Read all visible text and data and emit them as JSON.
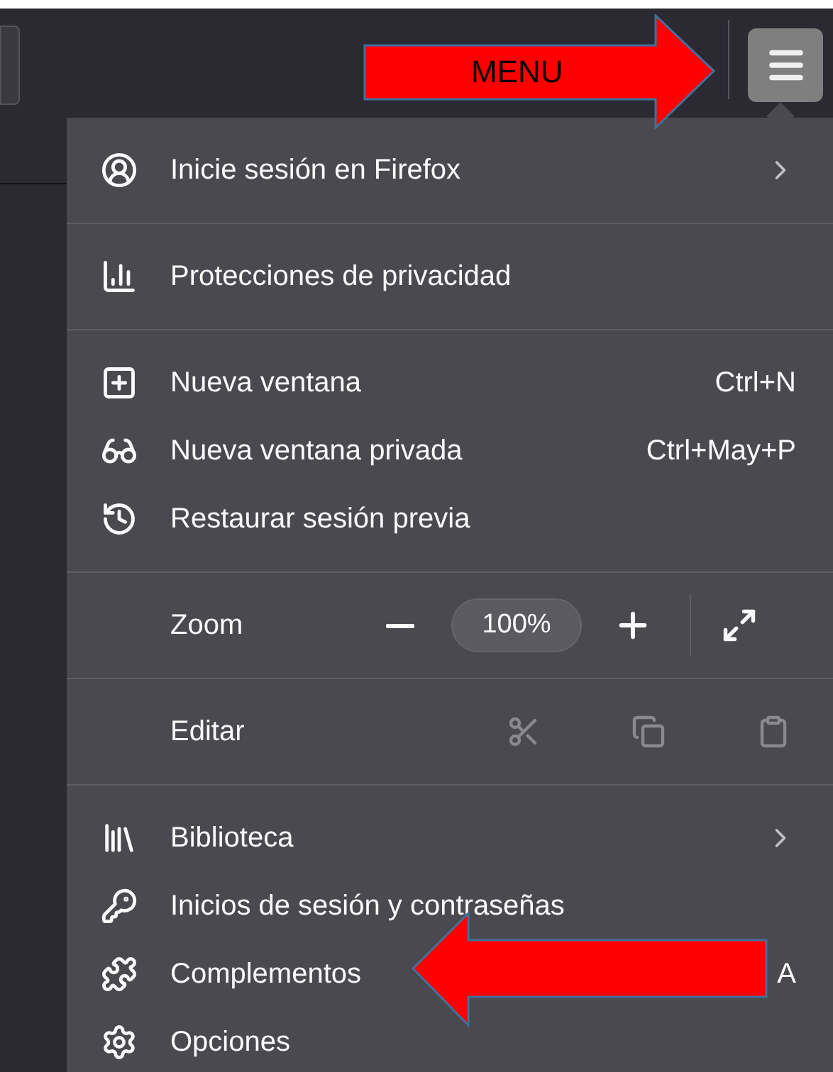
{
  "toolbar": {
    "menu_button": {
      "open": true
    }
  },
  "menu": {
    "sections": [
      {
        "items": [
          {
            "kind": "item",
            "label": "Inicie sesión en Firefox",
            "submenu": true
          }
        ]
      },
      {
        "items": [
          {
            "kind": "item",
            "label": "Protecciones de privacidad",
            "submenu": false
          }
        ]
      },
      {
        "items": [
          {
            "kind": "item",
            "label": "Nueva ventana",
            "shortcut": "Ctrl+N",
            "submenu": false
          },
          {
            "kind": "item",
            "label": "Nueva ventana privada",
            "shortcut": "Ctrl+May+P",
            "submenu": false
          },
          {
            "kind": "item",
            "label": "Restaurar sesión previa",
            "submenu": false
          }
        ]
      },
      {
        "items": [
          {
            "kind": "zoom",
            "label": "Zoom",
            "value": "100%"
          }
        ]
      },
      {
        "items": [
          {
            "kind": "edit",
            "label": "Editar",
            "actions": [
              {
                "disabled": true
              },
              {
                "disabled": true
              },
              {
                "disabled": true
              }
            ]
          }
        ]
      },
      {
        "items": [
          {
            "kind": "item",
            "label": "Biblioteca",
            "submenu": true
          },
          {
            "kind": "item",
            "label": "Inicios de sesión y contraseñas",
            "submenu": false
          },
          {
            "kind": "item",
            "label": "Complementos",
            "shortcut": "A",
            "submenu": false
          },
          {
            "kind": "item",
            "label": "Opciones",
            "submenu": false
          }
        ]
      }
    ]
  },
  "annotations": [
    {
      "kind": "right",
      "label": "MENU"
    },
    {
      "kind": "left"
    }
  ]
}
